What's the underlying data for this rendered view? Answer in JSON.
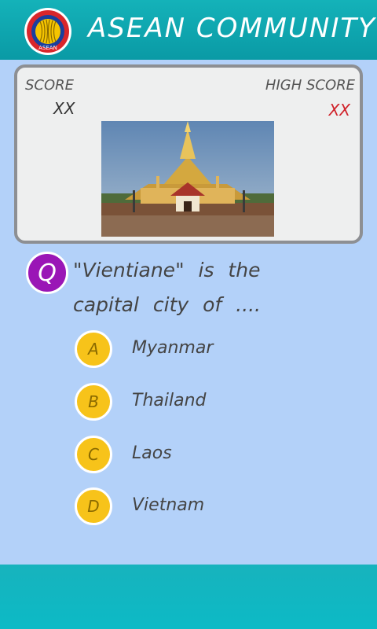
{
  "header": {
    "title": "ASEAN COMMUNITY",
    "logo_text": "ASEAN"
  },
  "score_card": {
    "score_label": "SCORE",
    "score_value": "XX",
    "high_score_label": "HIGH SCORE",
    "high_score_value": "XX"
  },
  "question": {
    "badge": "Q",
    "text": "\"Vientiane\" is the capital city of ...."
  },
  "options": [
    {
      "letter": "A",
      "label": "Myanmar"
    },
    {
      "letter": "B",
      "label": "Thailand"
    },
    {
      "letter": "C",
      "label": "Laos"
    },
    {
      "letter": "D",
      "label": "Vietnam"
    }
  ],
  "colors": {
    "header": "#14b2b9",
    "background": "#b3d1f9",
    "question_badge": "#9a16b6",
    "option_badge": "#f7c31a",
    "high_score": "#d0222a"
  }
}
